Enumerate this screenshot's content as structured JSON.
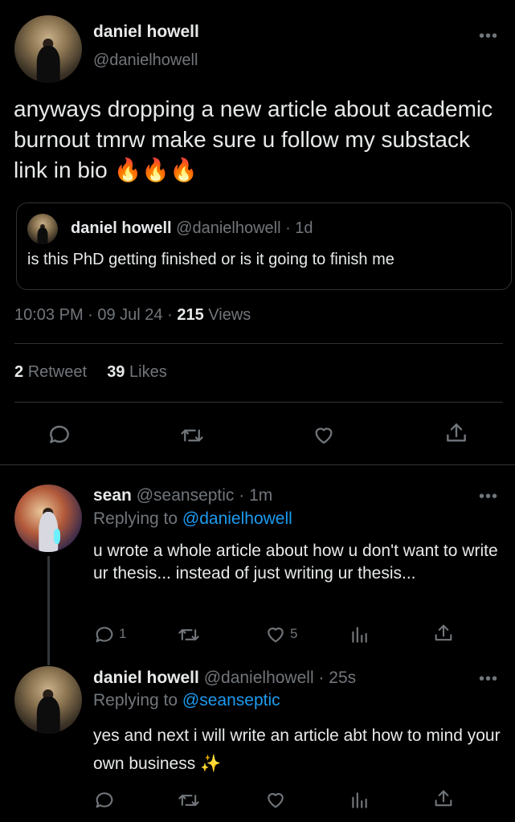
{
  "main_tweet": {
    "author_name": "daniel howell",
    "author_handle": "@danielhowell",
    "text": "anyways dropping a new article about academic burnout tmrw make sure u follow my substack link in bio",
    "emoji": "🔥🔥🔥",
    "quoted": {
      "author_name": "daniel howell",
      "author_handle": "@danielhowell",
      "time": "· 1d",
      "text": "is this PhD getting finished or is it going to finish me"
    },
    "timestamp": "10:03 PM · 09 Jul 24 ·",
    "views_count": "215",
    "views_label": "Views",
    "retweets_count": "2",
    "retweets_label": "Retweet",
    "likes_count": "39",
    "likes_label": "Likes"
  },
  "replies": [
    {
      "author_name": "sean",
      "author_handle": "@seanseptic",
      "time": "· 1m",
      "replying_prefix": "Replying to",
      "replying_to": "@danielhowell",
      "text": "u wrote a whole article about how u don't want to write ur thesis... instead of just writing ur thesis...",
      "reply_count": "1",
      "like_count": "5"
    },
    {
      "author_name": "daniel howell",
      "author_handle": "@danielhowell",
      "time": "· 25s",
      "replying_prefix": "Replying to",
      "replying_to": "@seanseptic",
      "text": "yes and next i will write an article abt how to mind your own business",
      "emoji": "✨"
    }
  ],
  "icons": [
    "more-icon",
    "reply-icon",
    "retweet-icon",
    "like-icon",
    "share-icon",
    "views-icon",
    "fire-icon",
    "sparkles-icon"
  ],
  "colors": {
    "background": "#000000",
    "text": "#e7e9ea",
    "muted": "#71767b",
    "link": "#1d9bf0",
    "divider": "#2f3336"
  }
}
